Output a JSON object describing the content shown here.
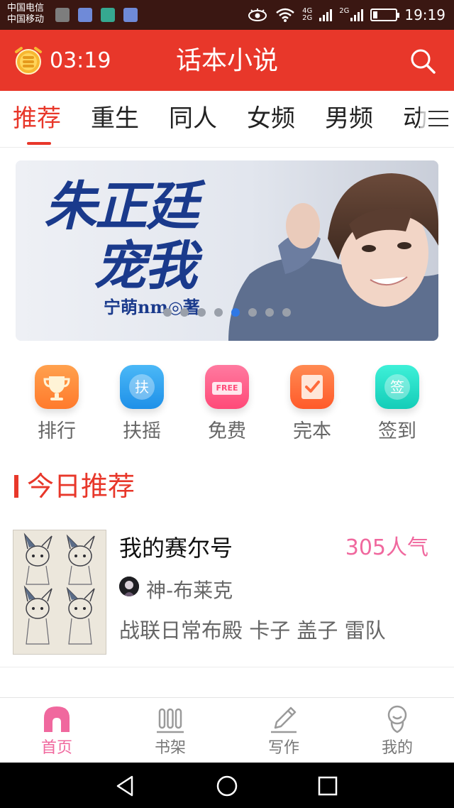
{
  "status_bar": {
    "carrier_1": "中国电信",
    "carrier_2": "中国移动",
    "network_top": "4G",
    "network_bottom": "2G",
    "network_2": "2G",
    "time": "19:19"
  },
  "app_bar": {
    "timer": "03:19",
    "title": "话本小说",
    "timer_icon": "alarm-clock-coins-icon",
    "search_icon": "search-icon"
  },
  "tabs": [
    {
      "label": "推荐",
      "active": true
    },
    {
      "label": "重生",
      "active": false
    },
    {
      "label": "同人",
      "active": false
    },
    {
      "label": "女频",
      "active": false
    },
    {
      "label": "男频",
      "active": false
    },
    {
      "label": "动",
      "active": false
    }
  ],
  "banner": {
    "title_line_1": "朱正廷",
    "title_line_2": "宠我",
    "author_line": "宁萌nm◎著",
    "slide_count": 8,
    "active_slide": 4
  },
  "quick_entries": [
    {
      "label": "排行",
      "icon": "trophy-icon",
      "color": "#ff8a3d"
    },
    {
      "label": "扶摇",
      "icon": "fuyao-icon",
      "color": "#2aa6f2",
      "glyph": "扶"
    },
    {
      "label": "免费",
      "icon": "free-icon",
      "color": "#ff5a86",
      "glyph": "FREE"
    },
    {
      "label": "完本",
      "icon": "complete-check-icon",
      "color": "#ff6a3a"
    },
    {
      "label": "签到",
      "icon": "checkin-icon",
      "color": "#20d8c4",
      "glyph": "签"
    }
  ],
  "section": {
    "title": "今日推荐"
  },
  "book": {
    "title": "我的赛尔号",
    "popularity": "305人气",
    "author": "神-布莱克",
    "tags": "战联日常布殿  卡子  盖子  雷队"
  },
  "bottom_nav": [
    {
      "label": "首页",
      "icon": "home-icon",
      "active": true
    },
    {
      "label": "书架",
      "icon": "bookshelf-icon",
      "active": false
    },
    {
      "label": "写作",
      "icon": "pen-icon",
      "active": false
    },
    {
      "label": "我的",
      "icon": "profile-icon",
      "active": false
    }
  ],
  "colors": {
    "brand": "#e8372a",
    "accent_pink": "#f0689e"
  }
}
